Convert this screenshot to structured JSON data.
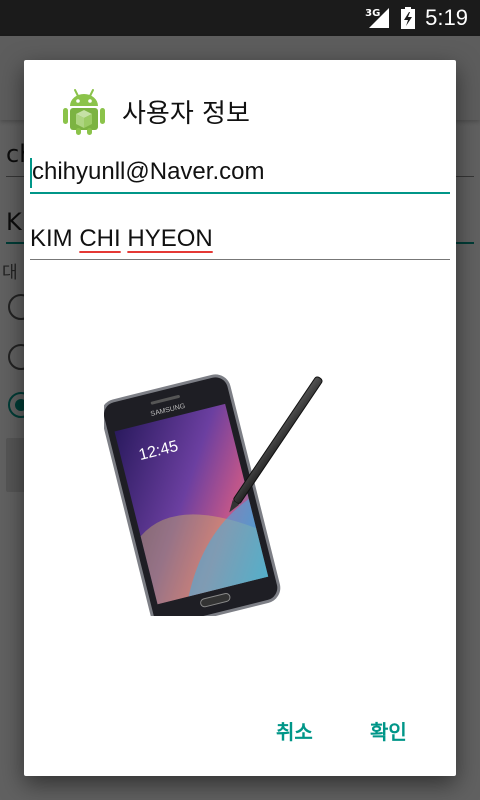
{
  "status_bar": {
    "network_type": "3G",
    "time": "5:19"
  },
  "background_app": {
    "field1_text": "ch",
    "field2_text": "K",
    "label_text": "대",
    "radio_options_checked": [
      false,
      false,
      true
    ]
  },
  "dialog": {
    "icon": "android-robot-icon",
    "title": "사용자 정보",
    "email_value": "chihyunll@Naver.com",
    "name_value_parts": [
      "KIM ",
      "CHI",
      " ",
      "HYEON"
    ],
    "image": "samsung-galaxy-note-phone-with-stylus",
    "phone_screen_time": "12:45",
    "phone_brand": "SAMSUNG",
    "cancel_label": "취소",
    "ok_label": "확인"
  },
  "colors": {
    "accent": "#009688",
    "spellcheck": "#e53935",
    "scrim": "rgba(0,0,0,0.6)"
  }
}
